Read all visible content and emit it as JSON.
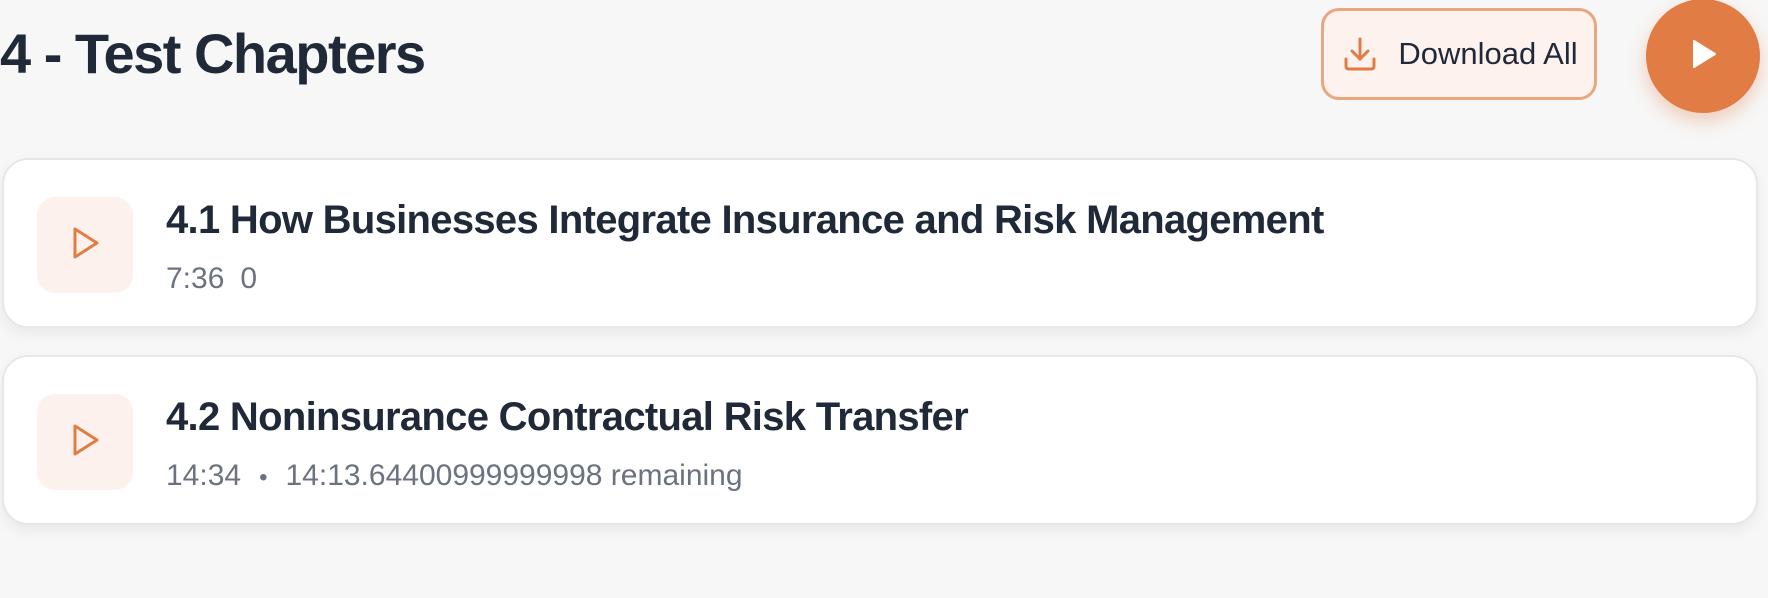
{
  "header": {
    "title": "4 - Test Chapters",
    "download_all_label": "Download All"
  },
  "chapters": [
    {
      "title": "4.1 How Businesses Integrate Insurance and Risk Management",
      "duration": "7:36",
      "progress": "0"
    },
    {
      "title": "4.2 Noninsurance Contractual Risk Transfer",
      "duration": "14:34",
      "separator": "•",
      "remaining": "14:13.64400999999998 remaining"
    }
  ],
  "icons": {
    "download": "download-icon",
    "play_all": "play-icon",
    "chapter_play": "play-outline-icon"
  },
  "colors": {
    "accent": "#e07c44",
    "accent_light": "#fdf2ee",
    "title_text": "#1f2937",
    "meta_text": "#6b7280",
    "background": "#f7f7f7"
  }
}
